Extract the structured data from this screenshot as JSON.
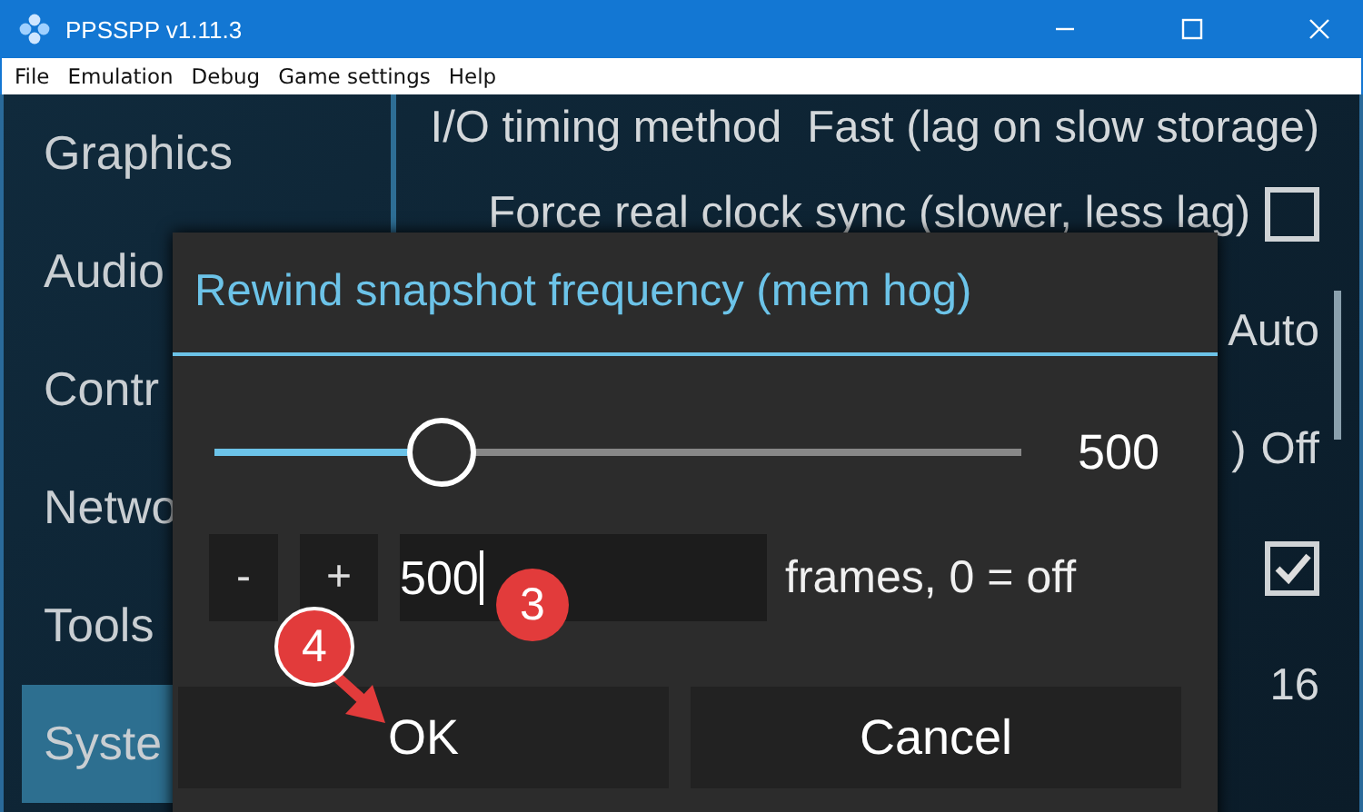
{
  "window": {
    "title": "PPSSPP v1.11.3"
  },
  "menu": [
    "File",
    "Emulation",
    "Debug",
    "Game settings",
    "Help"
  ],
  "sidebar": {
    "items": [
      {
        "label": "Graphics",
        "selected": false
      },
      {
        "label": "Audio",
        "selected": false
      },
      {
        "label": "Contr",
        "selected": false
      },
      {
        "label": "Netwo",
        "selected": false
      },
      {
        "label": "Tools",
        "selected": false
      },
      {
        "label": "Syste",
        "selected": true
      }
    ]
  },
  "settings": [
    {
      "kind": "value",
      "label": "I/O timing method",
      "value": "Fast (lag on slow storage)"
    },
    {
      "kind": "checkbox",
      "label": "Force real clock sync (slower, less lag)",
      "checked": false
    },
    {
      "kind": "value",
      "value": "Auto"
    },
    {
      "kind": "value",
      "label": ")",
      "value": "Off"
    },
    {
      "kind": "checkbox",
      "checked": true
    },
    {
      "kind": "value",
      "value": "16"
    }
  ],
  "dialog": {
    "title": "Rewind snapshot frequency (mem hog)",
    "slider": {
      "level": 0.28,
      "reading": "500"
    },
    "stepper": {
      "minus": "-",
      "plus": "+",
      "value": "500",
      "hint": "frames, 0 = off"
    },
    "buttons": [
      "OK",
      "Cancel"
    ]
  },
  "annotations": [
    {
      "label": "3"
    },
    {
      "label": "4"
    }
  ]
}
